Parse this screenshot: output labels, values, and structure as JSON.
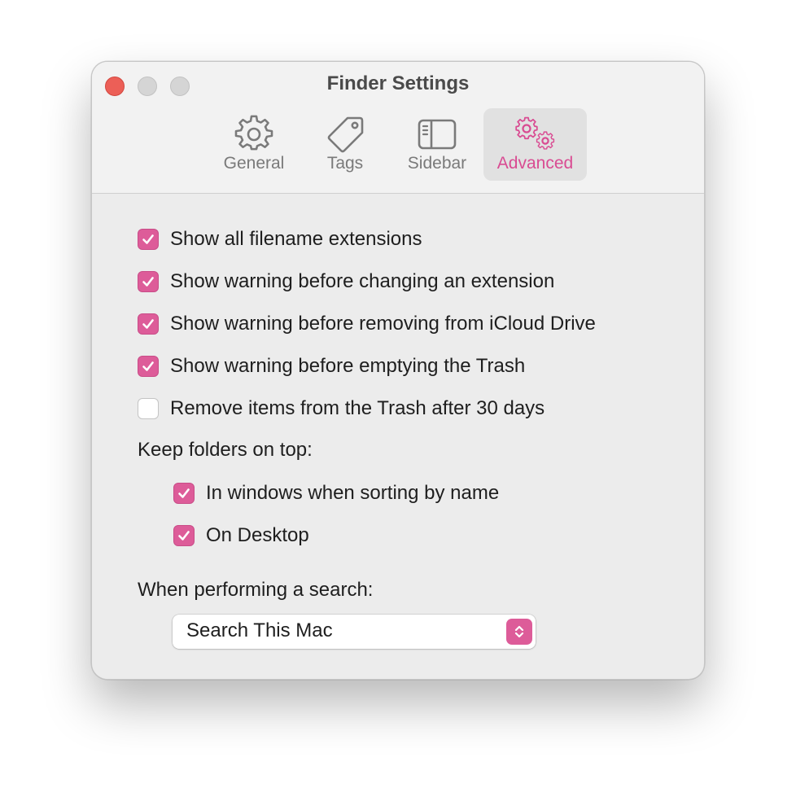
{
  "window": {
    "title": "Finder Settings"
  },
  "tabs": [
    {
      "label": "General",
      "icon": "gear-icon",
      "active": false
    },
    {
      "label": "Tags",
      "icon": "tag-icon",
      "active": false
    },
    {
      "label": "Sidebar",
      "icon": "sidebar-icon",
      "active": false
    },
    {
      "label": "Advanced",
      "icon": "gears-icon",
      "active": true
    }
  ],
  "options": [
    {
      "label": "Show all filename extensions",
      "checked": true
    },
    {
      "label": "Show warning before changing an extension",
      "checked": true
    },
    {
      "label": "Show warning before removing from iCloud Drive",
      "checked": true
    },
    {
      "label": "Show warning before emptying the Trash",
      "checked": true
    },
    {
      "label": "Remove items from the Trash after 30 days",
      "checked": false
    }
  ],
  "keep_folders": {
    "heading": "Keep folders on top:",
    "options": [
      {
        "label": "In windows when sorting by name",
        "checked": true
      },
      {
        "label": "On Desktop",
        "checked": true
      }
    ]
  },
  "search": {
    "heading": "When performing a search:",
    "selected": "Search This Mac"
  },
  "colors": {
    "accent": "#dd5c99",
    "close": "#ec5f57"
  }
}
